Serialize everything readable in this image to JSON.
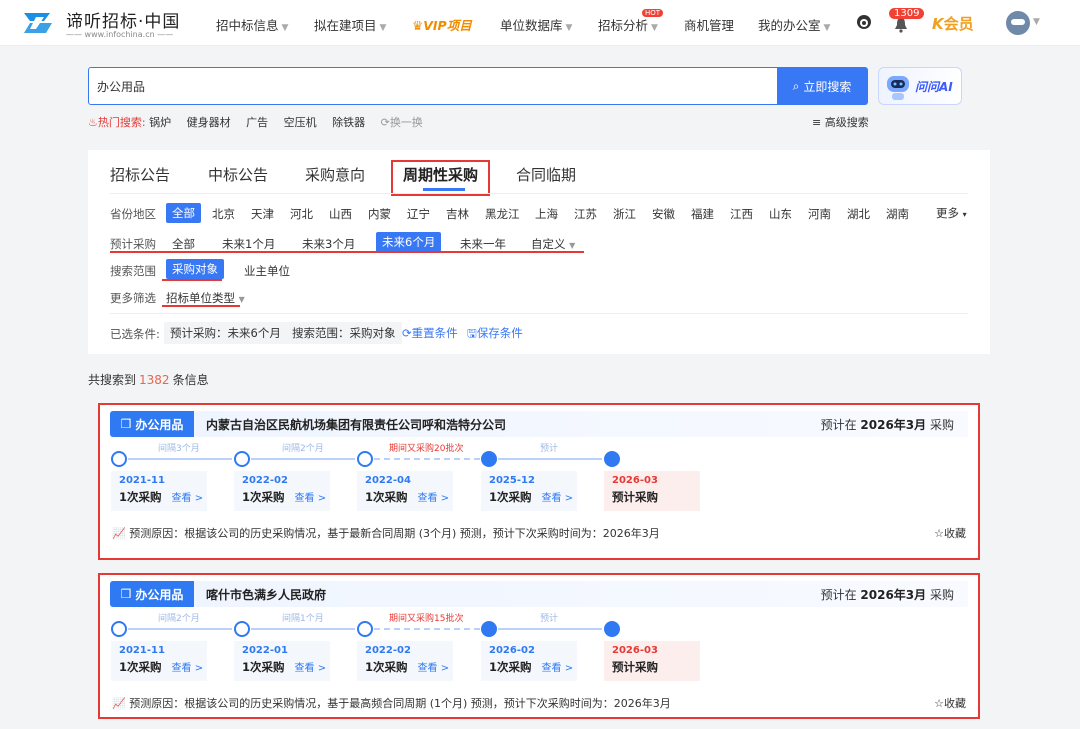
{
  "header": {
    "logo_title": "谛听招标·中国",
    "logo_sub": "—— www.infochina.cn ——",
    "nav": [
      "招中标信息",
      "拟在建项目",
      "VIP项目",
      "单位数据库",
      "招标分析",
      "商机管理",
      "我的办公室"
    ],
    "hot_badge": "HOT",
    "notif_count": "1309",
    "member_label": "会员"
  },
  "search": {
    "value": "办公用品",
    "button": "立即搜索",
    "ai_button": "问问AI",
    "hot_label": "热门搜索:",
    "hot_keywords": [
      "锅炉",
      "健身器材",
      "广告",
      "空压机",
      "除铁器"
    ],
    "swap": "换一换",
    "advanced": "高级搜索"
  },
  "tabs": [
    "招标公告",
    "中标公告",
    "采购意向",
    "周期性采购",
    "合同临期"
  ],
  "filters": {
    "region_label": "省份地区",
    "regions": [
      "全部",
      "北京",
      "天津",
      "河北",
      "山西",
      "内蒙",
      "辽宁",
      "吉林",
      "黑龙江",
      "上海",
      "江苏",
      "浙江",
      "安徽",
      "福建",
      "江西",
      "山东",
      "河南",
      "湖北",
      "湖南"
    ],
    "more": "更多",
    "forecast_label": "预计采购",
    "forecast": [
      "全部",
      "未来1个月",
      "未来3个月",
      "未来6个月",
      "未来一年",
      "自定义"
    ],
    "scope_label": "搜索范围",
    "scope": [
      "采购对象",
      "业主单位"
    ],
    "more_filter_label": "更多筛选",
    "more_filter": "招标单位类型",
    "selected_label": "已选条件:",
    "selected": [
      "预计采购：未来6个月",
      "搜索范围：采购对象"
    ],
    "reset": "重置条件",
    "save": "保存条件"
  },
  "results": {
    "prefix": "共搜索到",
    "count": "1382",
    "suffix": "条信息"
  },
  "cards": [
    {
      "category": "办公用品",
      "company": "内蒙古自治区民航机场集团有限责任公司呼和浩特分公司",
      "pred_prefix": "预计在",
      "pred_date": "2026年3月",
      "pred_suffix": "采购",
      "intervals": [
        "间隔3个月",
        "间隔2个月",
        "期间又采购20批次",
        "预计"
      ],
      "nodes": [
        {
          "date": "2021-11",
          "count": "1次采购",
          "view": "查看 >"
        },
        {
          "date": "2022-02",
          "count": "1次采购",
          "view": "查看 >"
        },
        {
          "date": "2022-04",
          "count": "1次采购",
          "view": "查看 >"
        },
        {
          "date": "2025-12",
          "count": "1次采购",
          "view": "查看 >"
        },
        {
          "date": "2026-03",
          "count": "预计采购",
          "view": ""
        }
      ],
      "reason": "预测原因：根据该公司的历史采购情况，基于最新合同周期 (3个月) 预测，预计下次采购时间为：2026年3月",
      "fav": "收藏"
    },
    {
      "category": "办公用品",
      "company": "喀什市色满乡人民政府",
      "pred_prefix": "预计在",
      "pred_date": "2026年3月",
      "pred_suffix": "采购",
      "intervals": [
        "间隔2个月",
        "间隔1个月",
        "期间又采购15批次",
        "预计"
      ],
      "nodes": [
        {
          "date": "2021-11",
          "count": "1次采购",
          "view": "查看 >"
        },
        {
          "date": "2022-01",
          "count": "1次采购",
          "view": "查看 >"
        },
        {
          "date": "2022-02",
          "count": "1次采购",
          "view": "查看 >"
        },
        {
          "date": "2026-02",
          "count": "1次采购",
          "view": "查看 >"
        },
        {
          "date": "2026-03",
          "count": "预计采购",
          "view": ""
        }
      ],
      "reason": "预测原因：根据该公司的历史采购情况，基于最高频合同周期 (1个月) 预测，预计下次采购时间为：2026年3月",
      "fav": "收藏"
    }
  ]
}
